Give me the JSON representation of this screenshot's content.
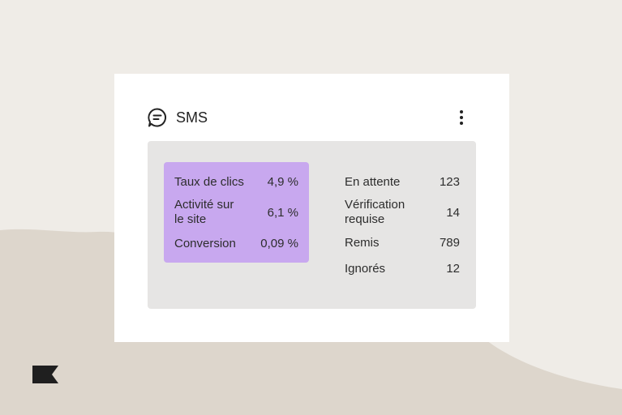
{
  "card": {
    "title": "SMS",
    "icon": "chat-bubble-icon",
    "menu_icon": "more-vertical-icon"
  },
  "metrics_left": [
    {
      "label_lines": [
        "Taux de clics"
      ],
      "value": "4,9 %"
    },
    {
      "label_lines": [
        "Activité sur",
        "le site"
      ],
      "value": "6,1 %"
    },
    {
      "label_lines": [
        "Conversion"
      ],
      "value": "0,09 %"
    }
  ],
  "metrics_right": [
    {
      "label_lines": [
        "En attente"
      ],
      "value": "123"
    },
    {
      "label_lines": [
        "Vérification",
        "requise"
      ],
      "value": "14"
    },
    {
      "label_lines": [
        "Remis"
      ],
      "value": "789"
    },
    {
      "label_lines": [
        "Ignorés"
      ],
      "value": "12"
    }
  ],
  "colors": {
    "background": "#efece7",
    "torn_paper": "#ddd6cc",
    "card": "#ffffff",
    "panel": "#e6e5e4",
    "highlight": "#c8a8ef",
    "text": "#2b2b2b"
  },
  "brand": {
    "icon": "flag-logo-icon"
  }
}
